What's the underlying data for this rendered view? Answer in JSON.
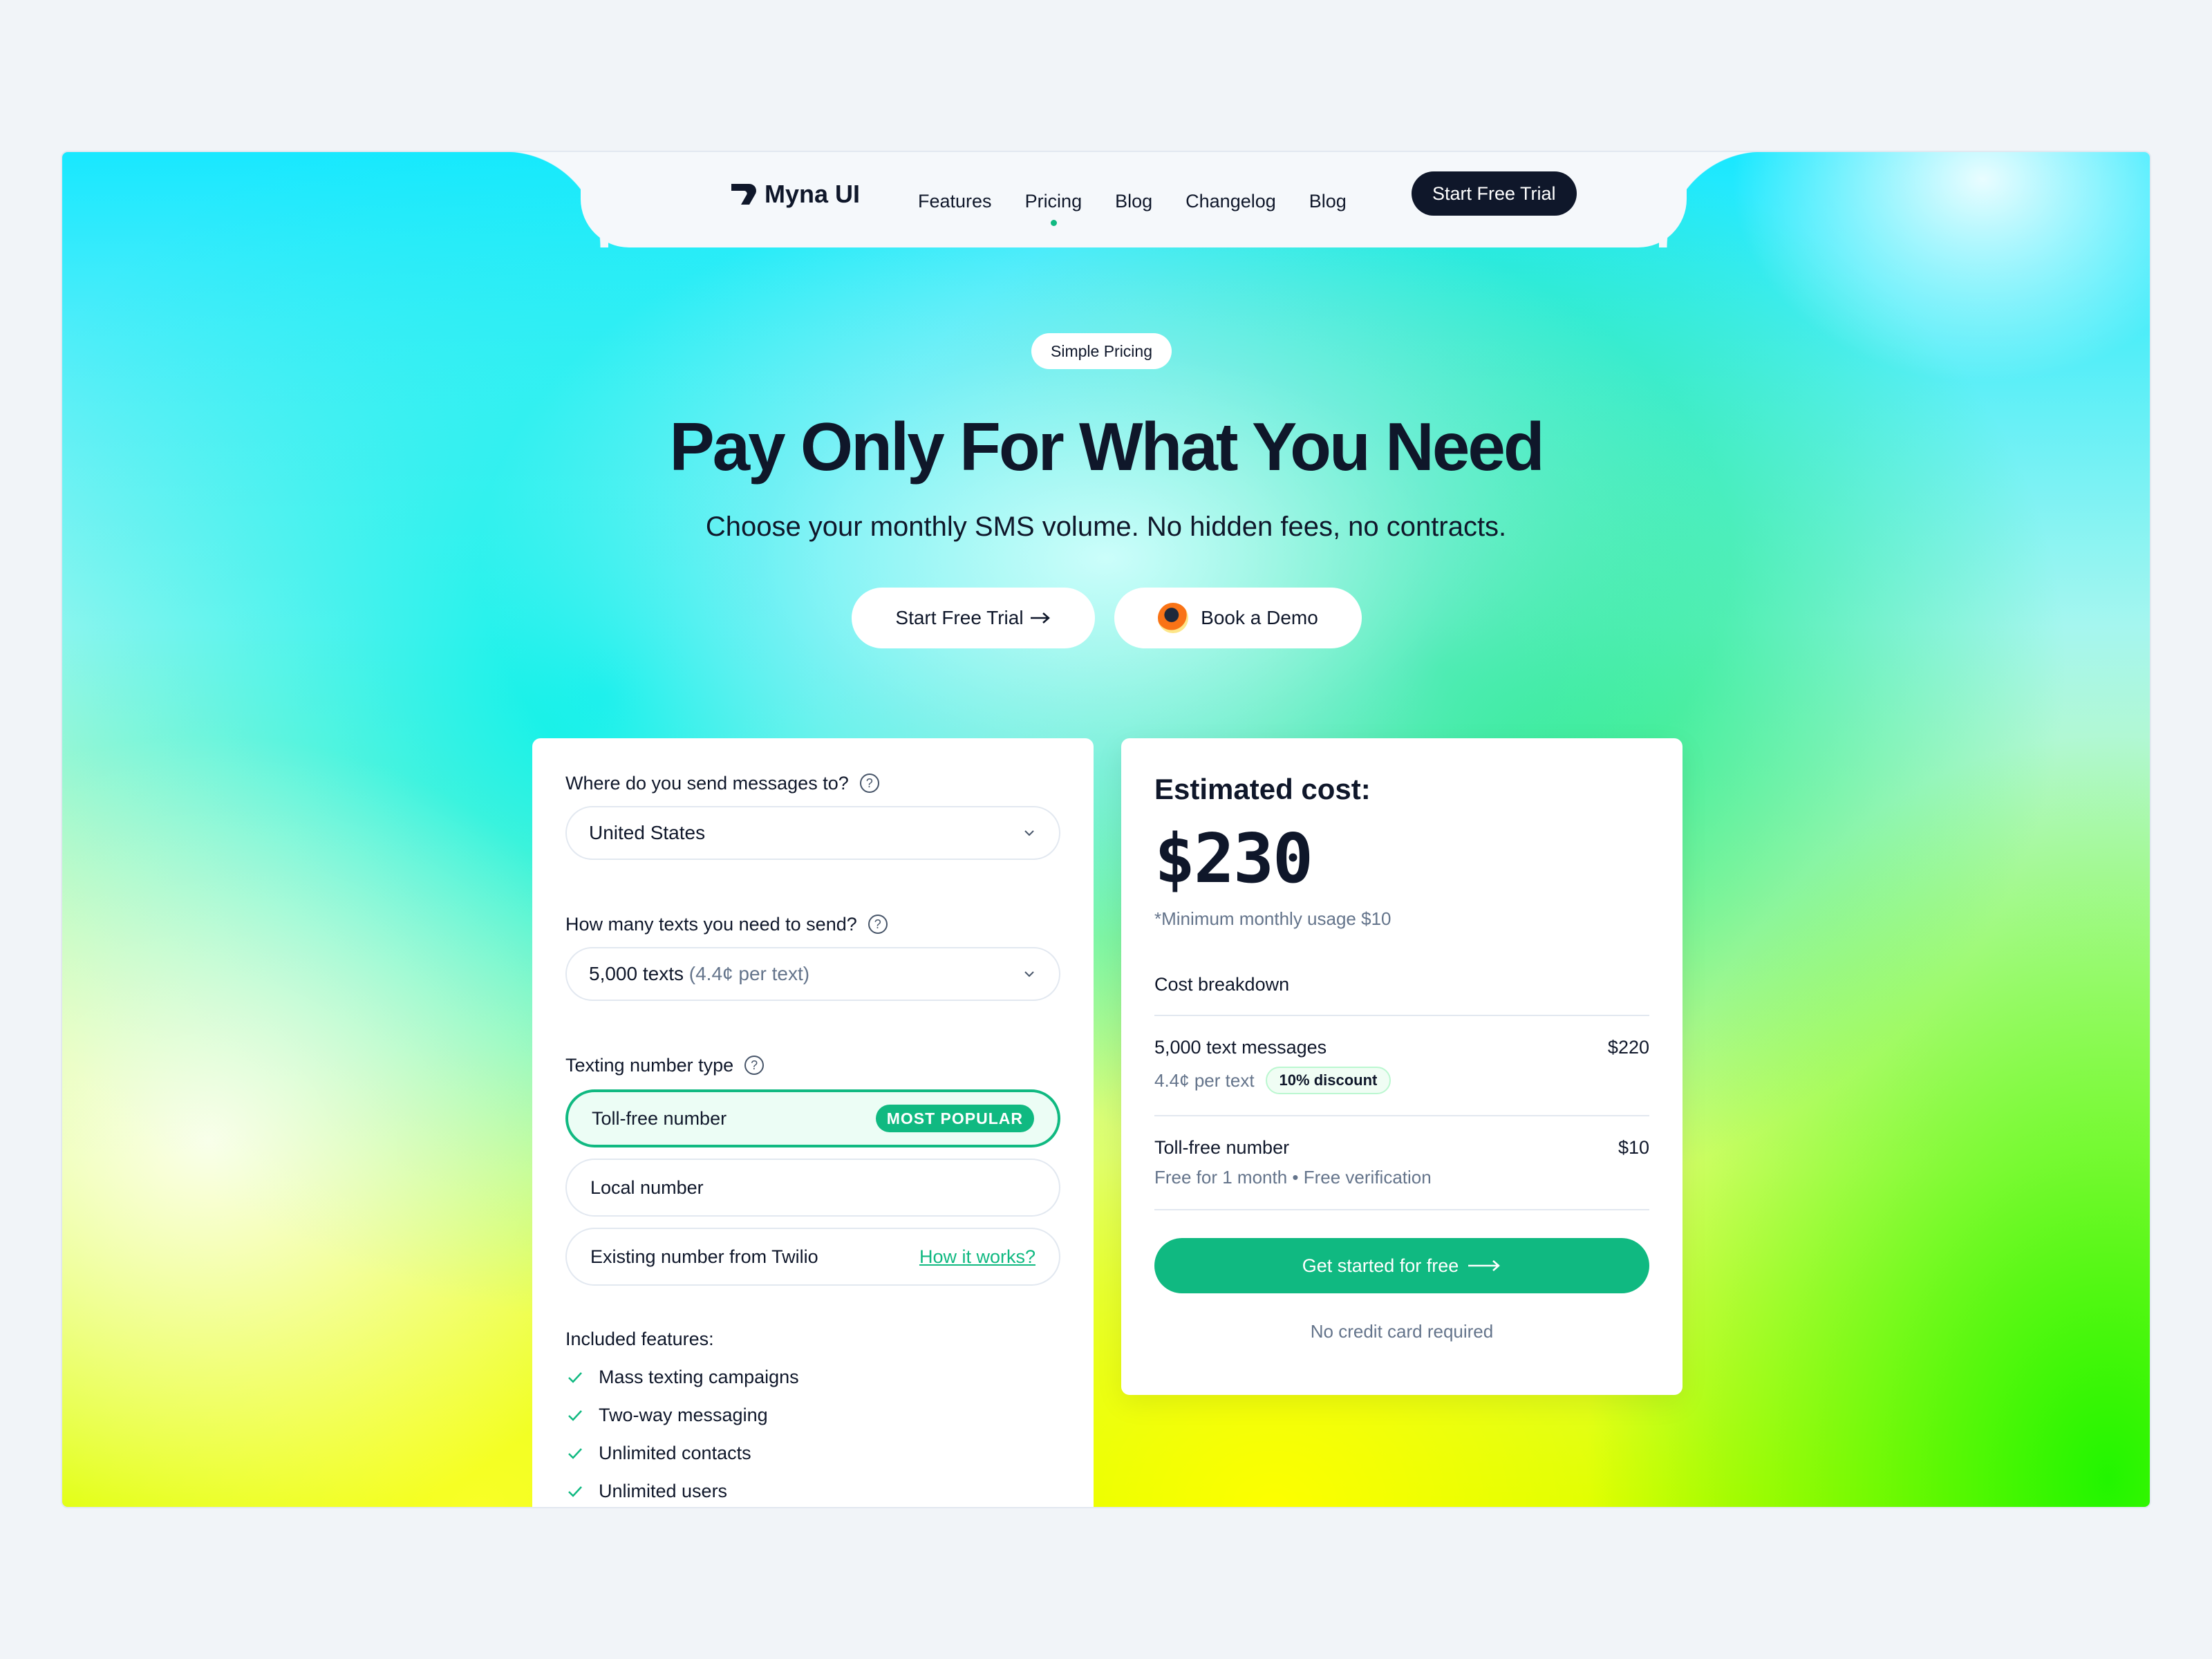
{
  "nav": {
    "brand": "Myna UI",
    "links": [
      "Features",
      "Pricing",
      "Blog",
      "Changelog",
      "Blog"
    ],
    "active_index": 1,
    "cta": "Start Free Trial"
  },
  "hero": {
    "pill": "Simple Pricing",
    "title": "Pay Only For What You Need",
    "subtitle": "Choose your monthly SMS volume. No hidden fees, no contracts.",
    "trial_button": "Start Free Trial",
    "demo_button": "Book a Demo"
  },
  "calculator": {
    "destination_label": "Where do you send messages to?",
    "destination_value": "United States",
    "volume_label": "How many texts you need to send?",
    "volume_value": "5,000 texts",
    "volume_rate": "(4.4¢ per text)",
    "number_type_label": "Texting number type",
    "options": [
      {
        "label": "Toll-free number",
        "badge": "MOST POPULAR",
        "selected": true
      },
      {
        "label": "Local number"
      },
      {
        "label": "Existing number from Twilio",
        "link": "How it works?"
      }
    ],
    "features_title": "Included features:",
    "features": [
      "Mass texting campaigns",
      "Two-way messaging",
      "Unlimited contacts",
      "Unlimited users"
    ]
  },
  "estimate": {
    "title": "Estimated cost:",
    "price": "$230",
    "minimum": "*Minimum monthly usage $10",
    "breakdown_title": "Cost breakdown",
    "rows": [
      {
        "label": "5,000 text messages",
        "amount": "$220",
        "sub": "4.4¢ per text",
        "badge": "10% discount"
      },
      {
        "label": "Toll-free number",
        "amount": "$10",
        "sub": "Free for 1 month • Free verification"
      }
    ],
    "cta": "Get started for free",
    "note": "No credit card required"
  },
  "colors": {
    "accent": "#10b981",
    "dark": "#0f172a",
    "muted": "#64748b"
  }
}
